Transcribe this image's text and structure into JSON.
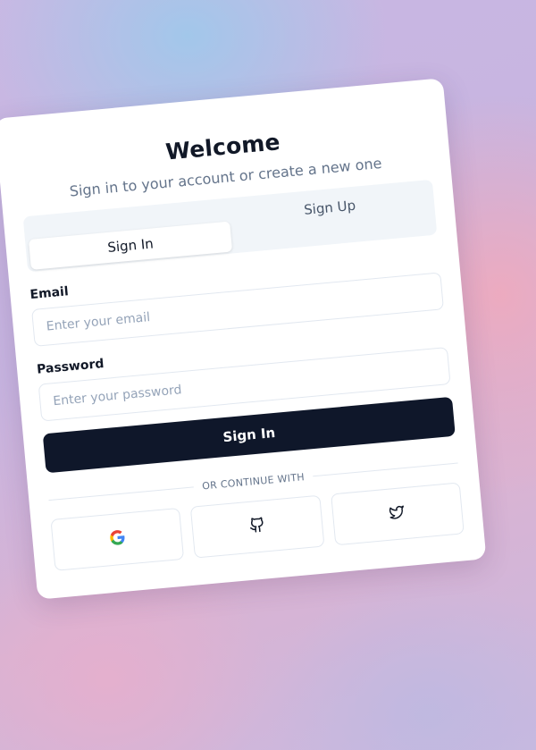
{
  "card": {
    "title": "Welcome",
    "subtitle": "Sign in to your account or create a new one"
  },
  "tabs": [
    {
      "label": "Sign In",
      "active": true
    },
    {
      "label": "Sign Up",
      "active": false
    }
  ],
  "form": {
    "email_label": "Email",
    "email_placeholder": "Enter your email",
    "password_label": "Password",
    "password_placeholder": "Enter your password",
    "submit_label": "Sign In"
  },
  "divider_text": "OR CONTINUE WITH",
  "social": [
    {
      "name": "google",
      "icon": "google-icon"
    },
    {
      "name": "github",
      "icon": "github-icon"
    },
    {
      "name": "twitter",
      "icon": "twitter-icon"
    }
  ],
  "colors": {
    "primary_button": "#0f172a",
    "muted_text": "#64748b",
    "tab_track": "#f1f5f9"
  }
}
